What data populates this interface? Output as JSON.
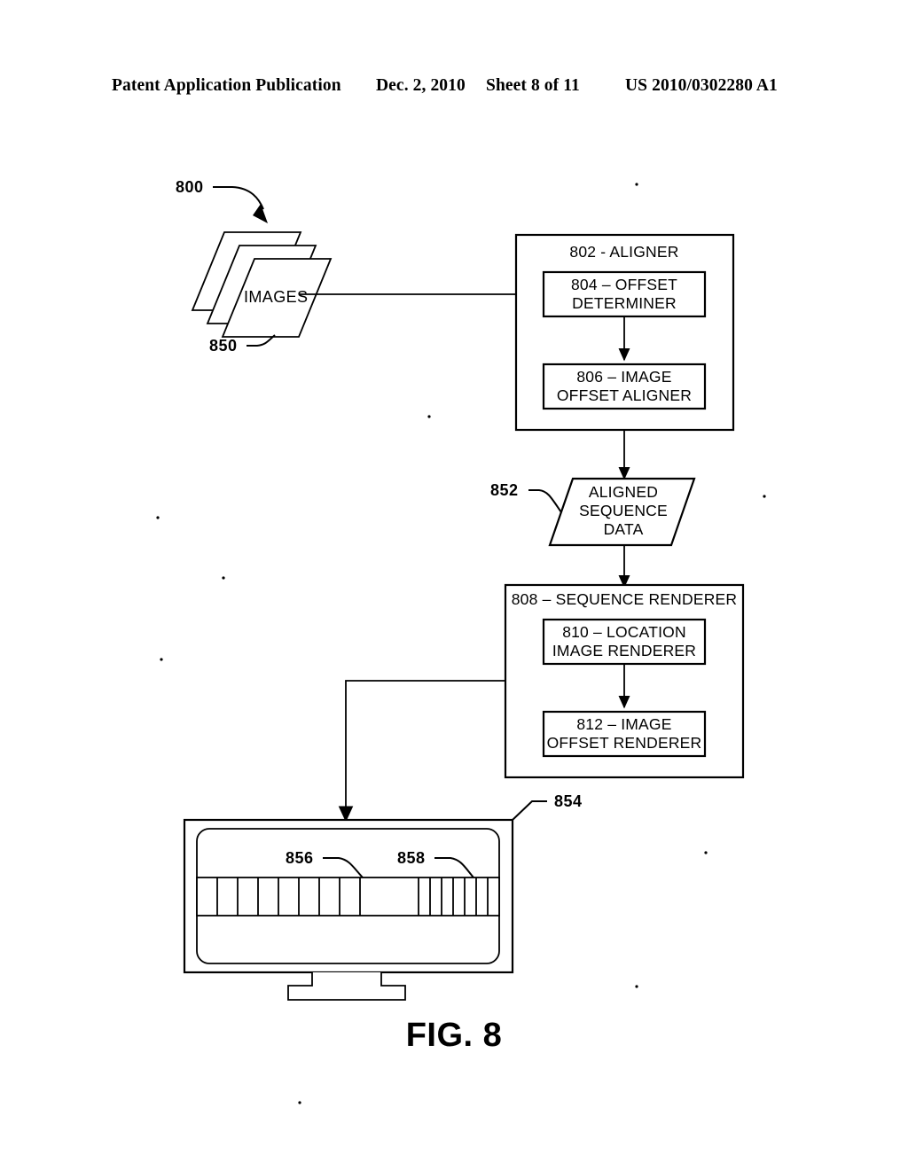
{
  "header": {
    "publication": "Patent Application Publication",
    "date": "Dec. 2, 2010",
    "sheet": "Sheet 8 of 11",
    "number": "US 2010/0302280 A1"
  },
  "figure": {
    "caption": "FIG. 8",
    "system_ref": "800",
    "colors": {
      "ink": "#000000",
      "paper": "#ffffff"
    },
    "nodes": {
      "images": {
        "ref": "850",
        "label": "IMAGES",
        "shape": "stacked-parallelograms",
        "sheet_count": 3
      },
      "aligner": {
        "ref_label": "802 - ALIGNER",
        "ref_num": "802",
        "ref_name": "ALIGNER",
        "children": [
          {
            "ref_num": "804",
            "line1": "804 – OFFSET",
            "line2": "DETERMINER"
          },
          {
            "ref_num": "806",
            "line1": "806 – IMAGE",
            "line2": "OFFSET ALIGNER"
          }
        ]
      },
      "aligned_sequence_data": {
        "ref": "852",
        "shape": "parallelogram",
        "line1": "ALIGNED",
        "line2": "SEQUENCE",
        "line3": "DATA"
      },
      "sequence_renderer": {
        "ref_label": "808 – SEQUENCE RENDERER",
        "ref_num": "808",
        "ref_name": "SEQUENCE RENDERER",
        "children": [
          {
            "ref_num": "810",
            "line1": "810 – LOCATION",
            "line2": "IMAGE RENDERER"
          },
          {
            "ref_num": "812",
            "line1": "812 – IMAGE",
            "line2": "OFFSET RENDERER"
          }
        ]
      },
      "display": {
        "ref": "854",
        "shape": "monitor",
        "filmstrip": {
          "expanded_region_ref": "856",
          "thumbnail_region_ref": "858",
          "left_cell_count": 8,
          "right_cell_count": 7,
          "gap_present": true
        }
      }
    },
    "connections": [
      {
        "from": "images",
        "to": "804 – OFFSET DETERMINER",
        "style": "arrow"
      },
      {
        "from": "804 – OFFSET DETERMINER",
        "to": "806 – IMAGE OFFSET ALIGNER",
        "style": "arrow"
      },
      {
        "from": "802 - ALIGNER",
        "to": "ALIGNED SEQUENCE DATA",
        "style": "arrow"
      },
      {
        "from": "ALIGNED SEQUENCE DATA",
        "to": "808 – SEQUENCE RENDERER",
        "style": "arrow"
      },
      {
        "from": "810 – LOCATION IMAGE RENDERER",
        "to": "812 – IMAGE OFFSET RENDERER",
        "style": "arrow"
      },
      {
        "from": "808 – SEQUENCE RENDERER",
        "to": "854 display",
        "style": "elbow-arrow"
      }
    ]
  }
}
